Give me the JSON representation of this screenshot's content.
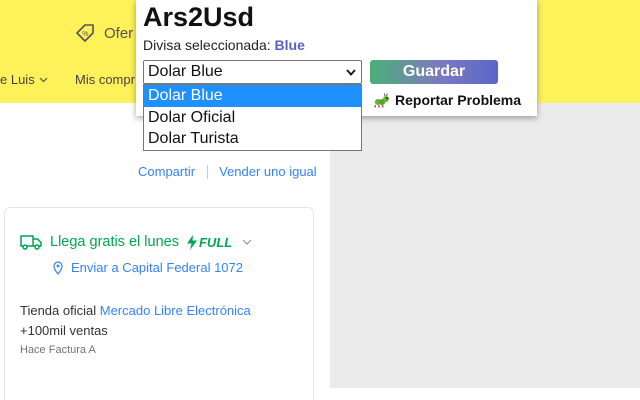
{
  "background_page": {
    "header": {
      "ofertas_label": "Ofer",
      "user_nav_label": "e Luis",
      "compras_nav_label": "Mis compr"
    },
    "share_link": "Compartir",
    "sell_link": "Vender uno igual",
    "shipping": {
      "arrival_text": "Llega gratis el lunes",
      "full_badge": "FULL",
      "send_to_text": "Enviar a Capital Federal 1072"
    },
    "seller": {
      "store_prefix": "Tienda oficial",
      "store_name": "Mercado Libre Electrónica",
      "sales": "+100mil ventas",
      "invoice": "Hace Factura A"
    }
  },
  "popup": {
    "title": "Ars2Usd",
    "selected_label": "Divisa seleccionada:",
    "selected_value": "Blue",
    "select_current": "Dolar Blue",
    "save_button": "Guardar",
    "report_label": "Reportar Problema",
    "dropdown_options": [
      "Dolar Blue",
      "Dolar Oficial",
      "Dolar Turista"
    ],
    "selected_option_index": 0
  },
  "colors": {
    "ml_yellow": "#fff159",
    "ml_blue_link": "#3483fa",
    "ml_green": "#00a650",
    "selection_accent": "#5561c9",
    "dropdown_highlight": "#1e90ff"
  },
  "icons": {
    "ofertas": "discount-tag-icon",
    "shipping": "truck-icon",
    "full": "lightning-bolt-icon",
    "location": "location-pin-icon",
    "report": "bug-icon",
    "dropdown": "chevron-down-icon"
  }
}
